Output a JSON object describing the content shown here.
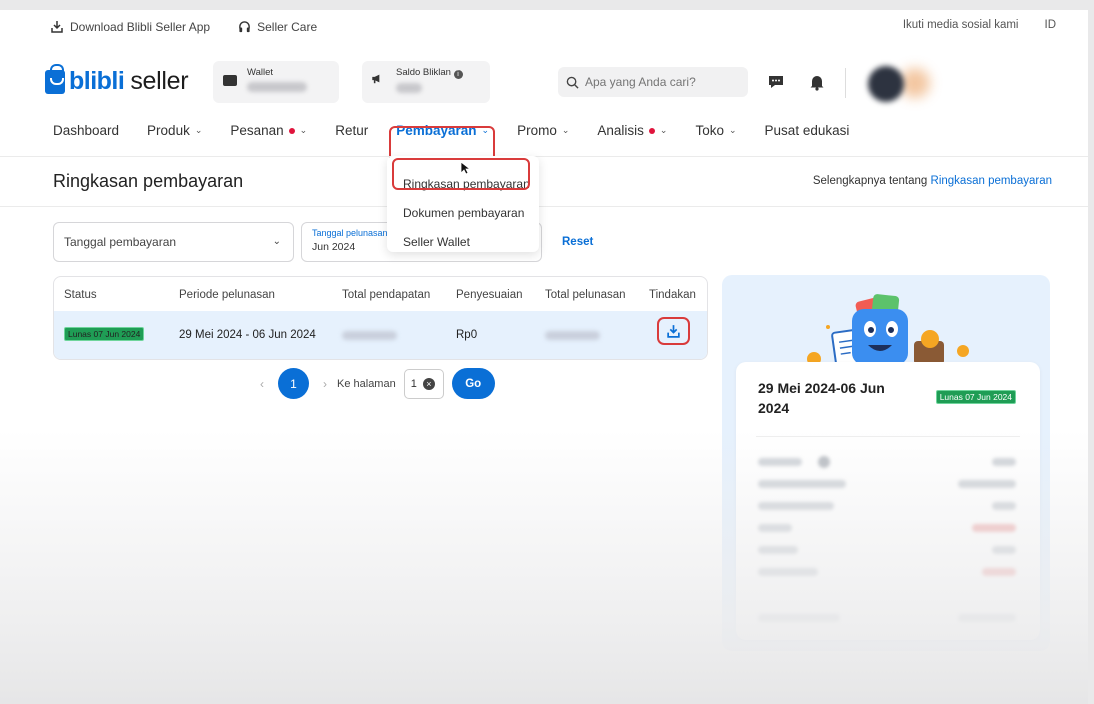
{
  "util_bar": {
    "download_app": "Download Blibli Seller App",
    "seller_care": "Seller Care",
    "follow_social": "Ikuti media sosial kami",
    "language": "ID"
  },
  "header": {
    "brand_bold": "blibli",
    "brand_light": "seller",
    "wallet_label": "Wallet",
    "saldo_label": "Saldo Bliklan",
    "search_placeholder": "Apa yang Anda cari?"
  },
  "nav": {
    "items": [
      {
        "label": "Dashboard",
        "dropdown": false,
        "dot": false
      },
      {
        "label": "Produk",
        "dropdown": true,
        "dot": false
      },
      {
        "label": "Pesanan",
        "dropdown": true,
        "dot": true
      },
      {
        "label": "Retur",
        "dropdown": false,
        "dot": false
      },
      {
        "label": "Pembayaran",
        "dropdown": true,
        "dot": false,
        "active": true
      },
      {
        "label": "Promo",
        "dropdown": true,
        "dot": false
      },
      {
        "label": "Analisis",
        "dropdown": true,
        "dot": true
      },
      {
        "label": "Toko",
        "dropdown": true,
        "dot": false
      },
      {
        "label": "Pusat edukasi",
        "dropdown": false,
        "dot": false
      }
    ]
  },
  "dropdown_menu": {
    "items": [
      "Ringkasan pembayaran",
      "Dokumen pembayaran",
      "Seller Wallet"
    ]
  },
  "page": {
    "title": "Ringkasan pembayaran",
    "more_prefix": "Selengkapnya tentang",
    "more_link": "Ringkasan pembayaran"
  },
  "filters": {
    "date_type": "Tanggal pembayaran",
    "date_label": "Tanggal pelunasan",
    "date_value": "Jun 2024",
    "reset": "Reset"
  },
  "table": {
    "headers": [
      "Status",
      "Periode pelunasan",
      "Total pendapatan",
      "Penyesuaian",
      "Total pelunasan",
      "Tindakan"
    ],
    "rows": [
      {
        "status": "Lunas 07 Jun 2024",
        "period": "29 Mei 2024 - 06 Jun 2024",
        "adjustment": "Rp0"
      }
    ]
  },
  "pagination": {
    "current": "1",
    "goto_label": "Ke halaman",
    "goto_value": "1",
    "go": "Go"
  },
  "summary": {
    "title": "29 Mei 2024-06 Jun 2024",
    "badge": "Lunas 07 Jun 2024"
  },
  "colors": {
    "brand_blue": "#0a6fd6",
    "highlight_red": "#d93b3b",
    "status_green": "#1f9d55",
    "row_highlight": "#e6f1fd"
  }
}
